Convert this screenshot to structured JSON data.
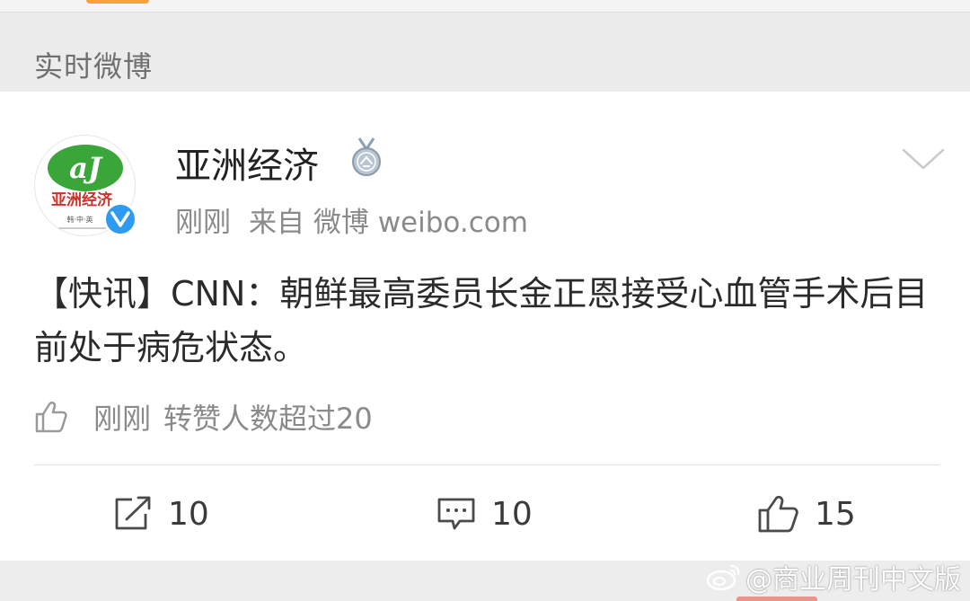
{
  "section": {
    "title": "实时微博"
  },
  "post": {
    "username": "亚洲经济",
    "meta": {
      "time": "刚刚",
      "source": "来自 微博 weibo.com"
    },
    "content": "【快讯】CNN：朝鲜最高委员长金正恩接受心血管手术后目前处于病危状态。",
    "like_stats": {
      "time": "刚刚",
      "text": "转赞人数超过20"
    },
    "actions": {
      "repost_count": "10",
      "comment_count": "10",
      "like_count": "15"
    }
  },
  "avatar": {
    "logo_letters": "aJ",
    "name_text": "亚洲经济",
    "sub_text": "韩·中·英"
  },
  "watermark": {
    "text": "@商业周刊中文版"
  },
  "colors": {
    "verified_blue": "#2d9cf0",
    "logo_green": "#3aa63a",
    "logo_red": "#d0302a",
    "accent_orange": "#f7a23a"
  },
  "icons": {
    "verified": "verified-v-icon",
    "medal": "medal-icon",
    "more": "chevron-down-icon",
    "like": "thumbs-up-icon",
    "repost": "share-icon",
    "comment": "comment-icon"
  }
}
